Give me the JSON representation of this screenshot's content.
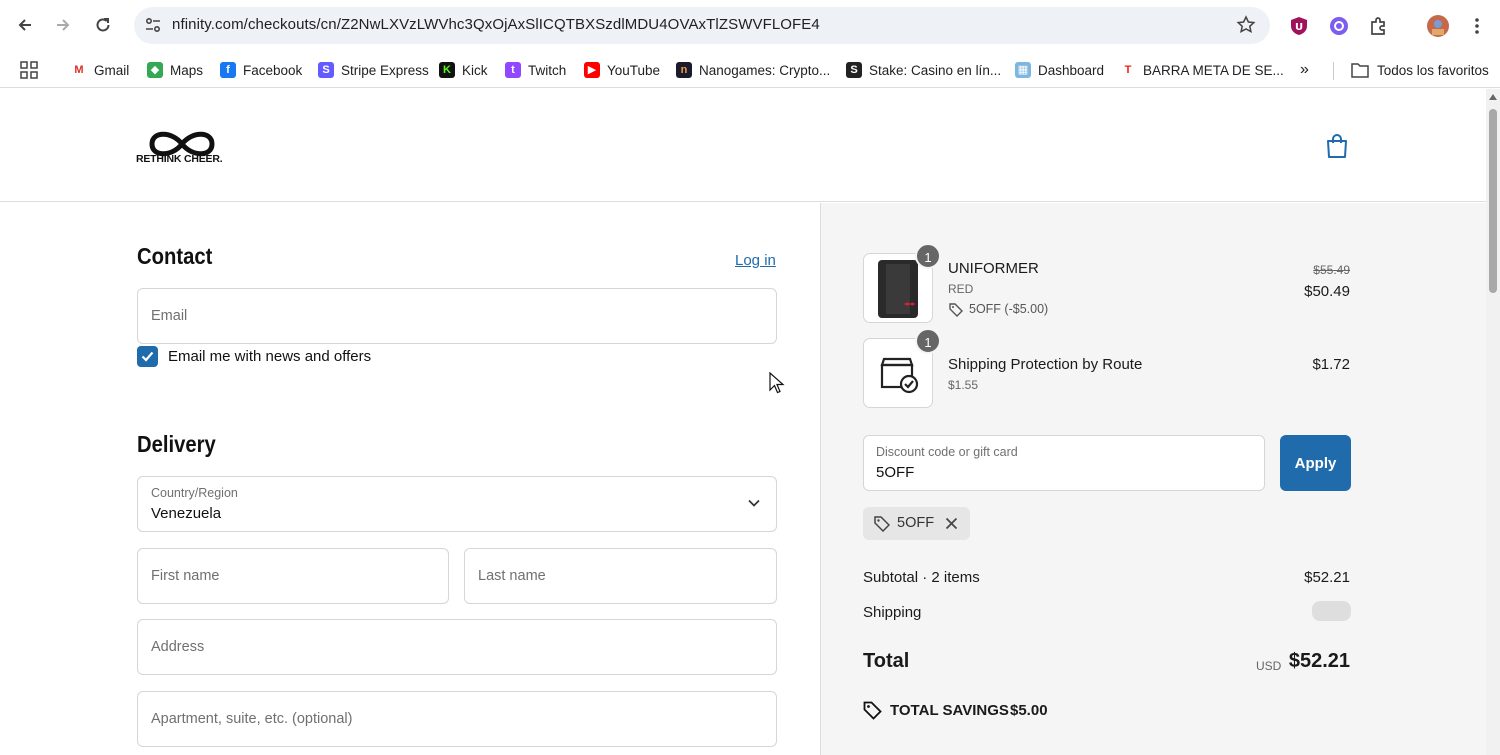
{
  "browser": {
    "url": "nfinity.com/checkouts/cn/Z2NwLXVzLWVhc3QxOjAxSlICQTBXSzdlMDU4OVAxTlZSWVFLOFE4",
    "bookmarks": [
      "Gmail",
      "Maps",
      "Facebook",
      "Stripe Express",
      "Kick",
      "Twitch",
      "YouTube",
      "Nanogames: Crypto...",
      "Stake: Casino en lín...",
      "Dashboard",
      "BARRA META DE SE..."
    ],
    "all_bookmarks": "Todos los favoritos",
    "more": "»"
  },
  "header": {
    "logo_text": "RETHINK CHEER."
  },
  "contact": {
    "title": "Contact",
    "login": "Log in",
    "email_placeholder": "Email",
    "newsletter_label": "Email me with news and offers",
    "newsletter_checked": true
  },
  "delivery": {
    "title": "Delivery",
    "country_label": "Country/Region",
    "country_value": "Venezuela",
    "first_name_placeholder": "First name",
    "last_name_placeholder": "Last name",
    "address_placeholder": "Address",
    "apartment_placeholder": "Apartment, suite, etc. (optional)"
  },
  "summary": {
    "items": [
      {
        "qty": "1",
        "name": "UNIFORMER",
        "variant": "RED",
        "discount": "5OFF (-$5.00)",
        "original_price": "$55.49",
        "price": "$50.49"
      },
      {
        "qty": "1",
        "name": "Shipping Protection by Route",
        "variant": "$1.55",
        "price": "$1.72"
      }
    ],
    "discount_label": "Discount code or gift card",
    "discount_value": "5OFF",
    "apply_label": "Apply",
    "applied_code": "5OFF",
    "subtotal_label": "Subtotal · 2 items",
    "subtotal_value": "$52.21",
    "shipping_label": "Shipping",
    "total_label": "Total",
    "currency": "USD",
    "total_value": "$52.21",
    "savings_label": "TOTAL SAVINGS",
    "savings_value": "$5.00"
  },
  "colors": {
    "accent": "#1f6bab",
    "summary_bg": "#f5f5f5"
  }
}
